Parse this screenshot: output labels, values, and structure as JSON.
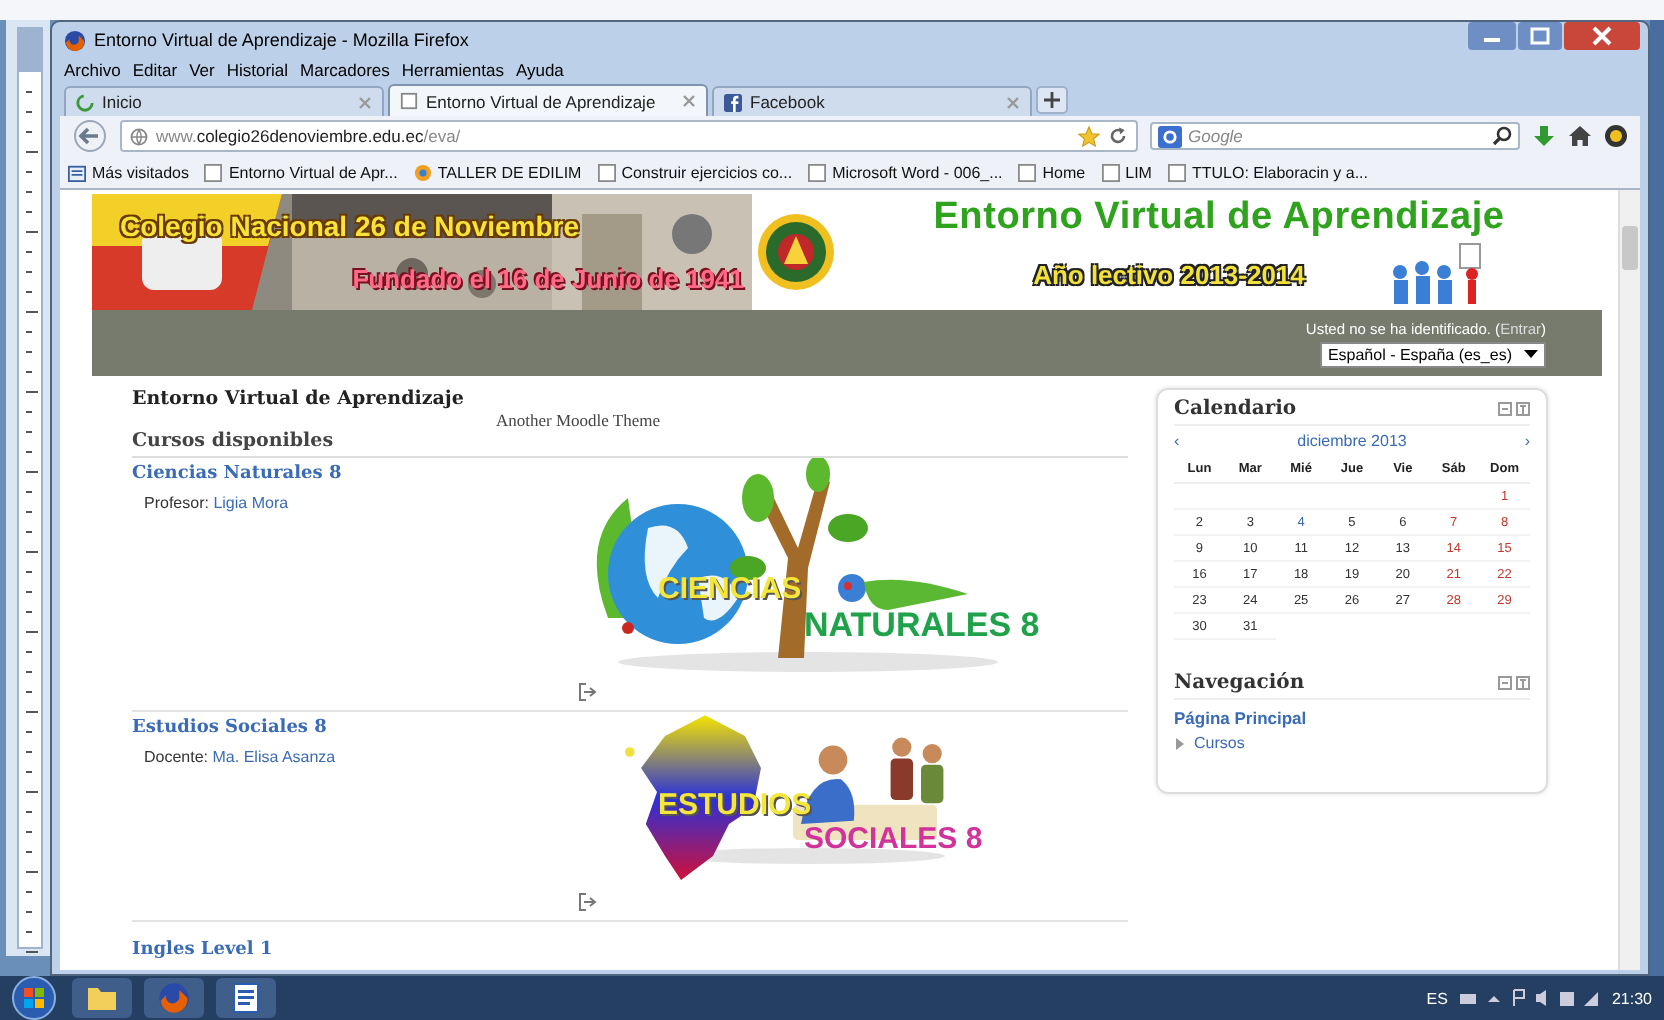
{
  "window": {
    "title": "Entorno Virtual de Aprendizaje - Mozilla Firefox"
  },
  "menu": [
    "Archivo",
    "Editar",
    "Ver",
    "Historial",
    "Marcadores",
    "Herramientas",
    "Ayuda"
  ],
  "tabs": [
    {
      "label": "Inicio",
      "selected": false,
      "kind": "loading"
    },
    {
      "label": "Entorno Virtual de Aprendizaje",
      "selected": true,
      "kind": "page"
    },
    {
      "label": "Facebook",
      "selected": false,
      "kind": "facebook"
    }
  ],
  "address": {
    "prefix": "www.",
    "host": "colegio26denoviembre.edu.ec",
    "path": "/eva/"
  },
  "search": {
    "placeholder": "Google"
  },
  "bookmarks": [
    {
      "label": "Más visitados",
      "kind": "folder"
    },
    {
      "label": "Entorno Virtual de Apr...",
      "kind": "page"
    },
    {
      "label": "TALLER DE EDILIM",
      "kind": "app"
    },
    {
      "label": "Construir ejercicios co...",
      "kind": "page"
    },
    {
      "label": "Microsoft Word - 006_...",
      "kind": "page"
    },
    {
      "label": "Home",
      "kind": "page"
    },
    {
      "label": "LIM",
      "kind": "page"
    },
    {
      "label": "TTULO: Elaboracin y a...",
      "kind": "page"
    }
  ],
  "banner": {
    "school": "Colegio Nacional 26 de Noviembre",
    "founded": "Fundado el 16 de Junio de 1941",
    "title": "Entorno Virtual de Aprendizaje",
    "year": "Año lectivo 2013-2014"
  },
  "login": {
    "text": "Usted no se ha identificado. (",
    "link": "Entrar",
    "after": ")"
  },
  "language": {
    "value": "Español - España (es_es)"
  },
  "site": {
    "title": "Entorno Virtual de Aprendizaje",
    "theme": "Another Moodle Theme",
    "heading": "Cursos disponibles"
  },
  "courses": [
    {
      "name": "Ciencias Naturales 8",
      "role": "Profesor:",
      "teacher": "Ligia Mora",
      "kind": "nature",
      "logo": [
        "CIENCIAS",
        "NATURALES 8"
      ]
    },
    {
      "name": "Estudios Sociales 8",
      "role": "Docente:",
      "teacher": "Ma. Elisa Asanza",
      "kind": "social",
      "logo": [
        "ESTUDIOS",
        "SOCIALES 8"
      ]
    },
    {
      "name": "Ingles Level 1"
    }
  ],
  "calendar": {
    "title": "Calendario",
    "prev": "‹",
    "month": "diciembre 2013",
    "next": "›",
    "weekdays": [
      "Lun",
      "Mar",
      "Mié",
      "Jue",
      "Vie",
      "Sáb",
      "Dom"
    ],
    "weeks": [
      {
        "kind": "start",
        "days": [
          {
            "d": "1",
            "kind": "weekend"
          }
        ]
      },
      {
        "days": [
          {
            "d": "2",
            "kind": "normal"
          },
          {
            "d": "3",
            "kind": "normal"
          },
          {
            "d": "4",
            "kind": "today"
          },
          {
            "d": "5",
            "kind": "normal"
          },
          {
            "d": "6",
            "kind": "normal"
          },
          {
            "d": "7",
            "kind": "weekend"
          },
          {
            "d": "8",
            "kind": "weekend"
          }
        ]
      },
      {
        "days": [
          {
            "d": "9",
            "kind": "normal"
          },
          {
            "d": "10",
            "kind": "normal"
          },
          {
            "d": "11",
            "kind": "normal"
          },
          {
            "d": "12",
            "kind": "normal"
          },
          {
            "d": "13",
            "kind": "normal"
          },
          {
            "d": "14",
            "kind": "weekend"
          },
          {
            "d": "15",
            "kind": "weekend"
          }
        ]
      },
      {
        "days": [
          {
            "d": "16",
            "kind": "normal"
          },
          {
            "d": "17",
            "kind": "normal"
          },
          {
            "d": "18",
            "kind": "normal"
          },
          {
            "d": "19",
            "kind": "normal"
          },
          {
            "d": "20",
            "kind": "normal"
          },
          {
            "d": "21",
            "kind": "weekend"
          },
          {
            "d": "22",
            "kind": "weekend"
          }
        ]
      },
      {
        "days": [
          {
            "d": "23",
            "kind": "normal"
          },
          {
            "d": "24",
            "kind": "normal"
          },
          {
            "d": "25",
            "kind": "normal"
          },
          {
            "d": "26",
            "kind": "normal"
          },
          {
            "d": "27",
            "kind": "normal"
          },
          {
            "d": "28",
            "kind": "weekend"
          },
          {
            "d": "29",
            "kind": "weekend"
          }
        ]
      },
      {
        "days": [
          {
            "d": "30",
            "kind": "normal"
          },
          {
            "d": "31",
            "kind": "normal"
          }
        ]
      }
    ]
  },
  "navigation": {
    "title": "Navegación",
    "home": "Página Principal",
    "items": [
      {
        "label": "Cursos",
        "expanded": false
      }
    ]
  },
  "taskbar": {
    "apps": [
      {
        "kind": "folder"
      },
      {
        "kind": "firefox"
      },
      {
        "kind": "word"
      }
    ],
    "language": "ES",
    "time": "21:30"
  }
}
